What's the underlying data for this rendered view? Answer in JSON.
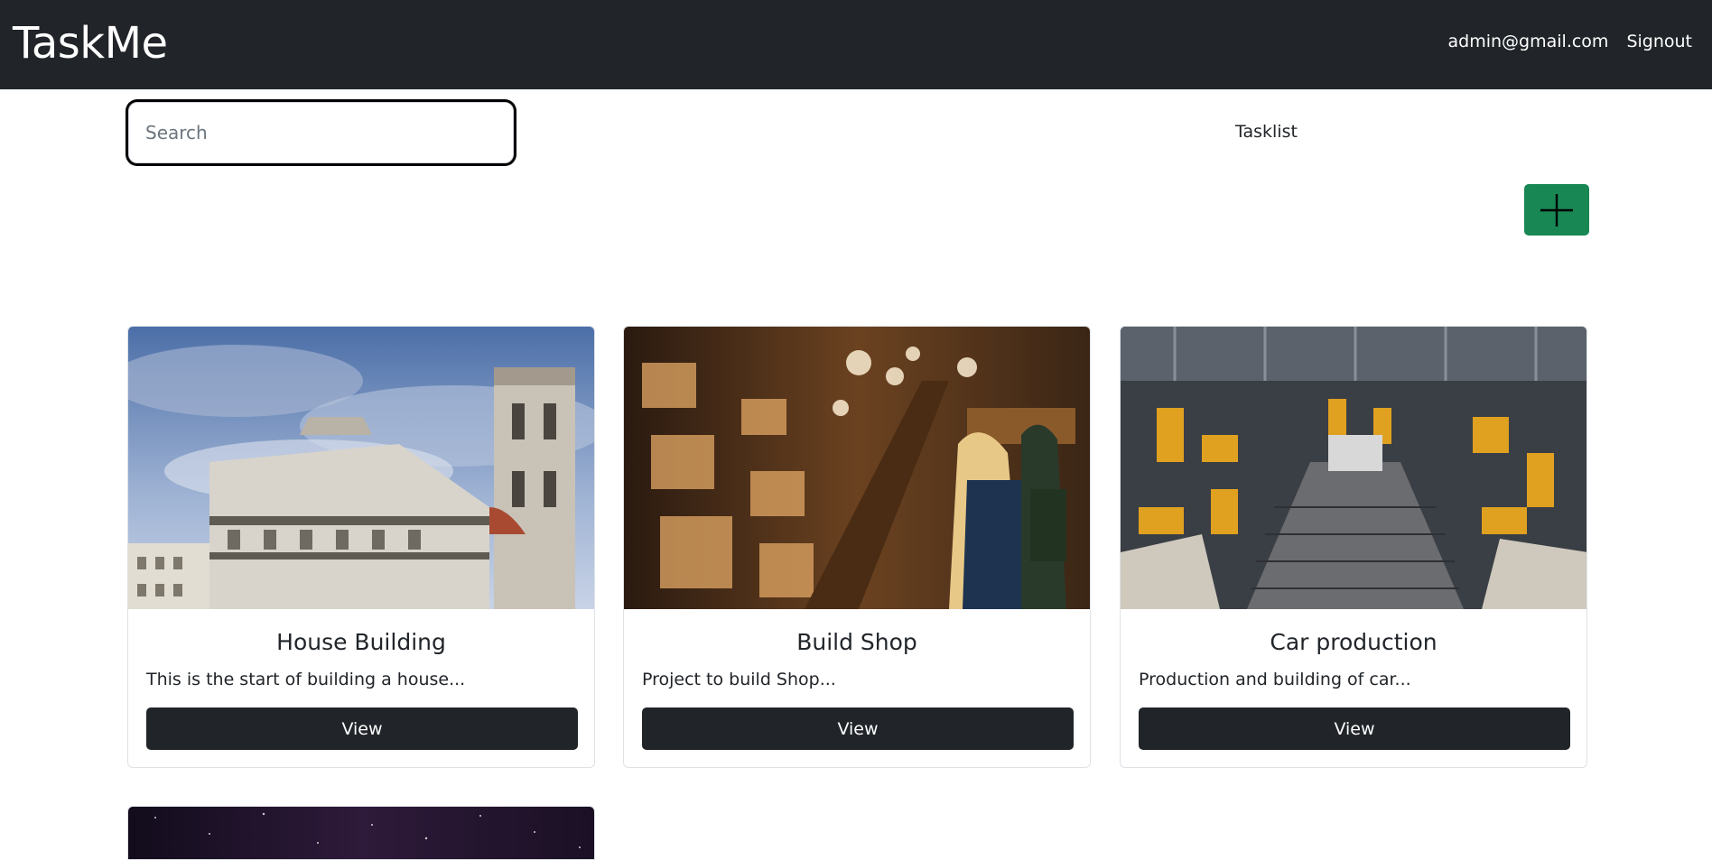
{
  "navbar": {
    "brand": "TaskMe",
    "user_email": "admin@gmail.com",
    "signout_label": "Signout"
  },
  "toolbar": {
    "search_placeholder": "Search",
    "tasklist_label": "Tasklist",
    "add_icon": "plus-icon",
    "add_color": "#198754"
  },
  "projects": [
    {
      "title": "House Building",
      "description": "This is the start of building a house...",
      "view_label": "View",
      "image": "cathedral-photo"
    },
    {
      "title": "Build Shop",
      "description": "Project to build Shop...",
      "view_label": "View",
      "image": "shop-interior-photo"
    },
    {
      "title": "Car production",
      "description": "Production and building of car...",
      "view_label": "View",
      "image": "factory-robots-photo"
    },
    {
      "image": "night-sky-photo"
    }
  ]
}
